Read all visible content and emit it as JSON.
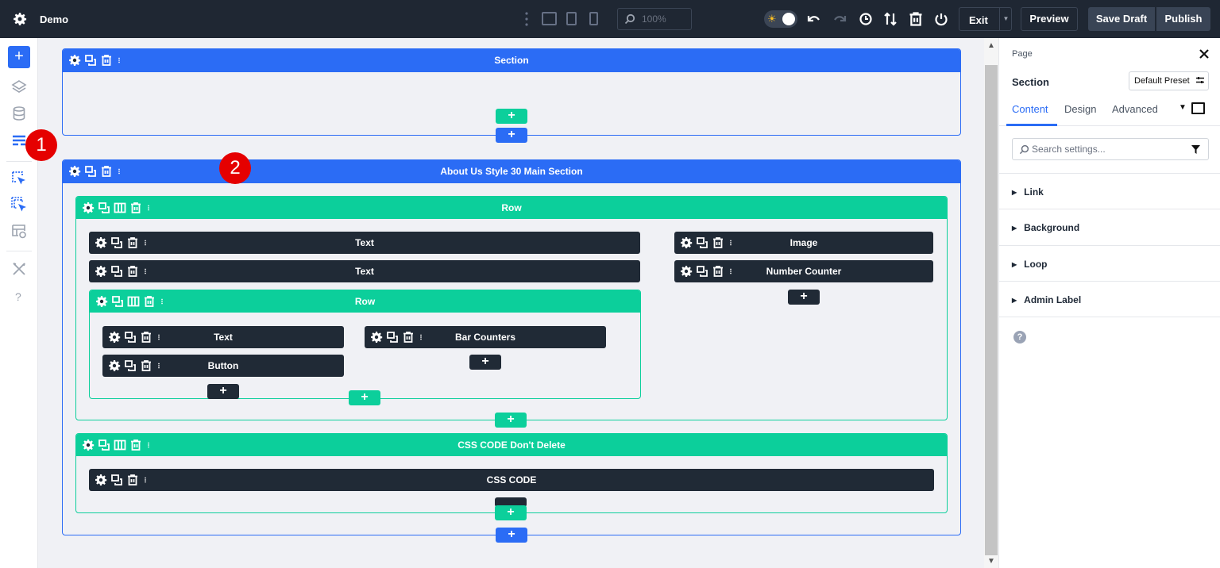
{
  "topbar": {
    "title": "Demo",
    "zoom_placeholder": "100%",
    "exit_label": "Exit",
    "preview_label": "Preview",
    "save_draft_label": "Save Draft",
    "publish_label": "Publish"
  },
  "sidebar": {
    "add_label": "+",
    "help_label": "?"
  },
  "annotations": [
    "1",
    "2"
  ],
  "canvas": {
    "section1": {
      "title": "Section"
    },
    "section2": {
      "title": "About Us Style 30 Main Section",
      "row1": {
        "title": "Row",
        "modules_left": [
          "Text",
          "Text"
        ],
        "modules_right": [
          "Image",
          "Number Counter"
        ],
        "inner_row": {
          "title": "Row",
          "col1_modules": [
            "Text",
            "Button"
          ],
          "col2_modules": [
            "Bar Counters"
          ]
        }
      },
      "row2": {
        "title": "CSS CODE Don't Delete",
        "modules": [
          "CSS CODE"
        ]
      }
    },
    "add_symbol": "+"
  },
  "panel": {
    "breadcrumb": "Page",
    "element_type": "Section",
    "preset_label": "Default Preset",
    "tabs": [
      "Content",
      "Design",
      "Advanced"
    ],
    "active_tab": "Content",
    "search_placeholder": "Search settings...",
    "groups": [
      "Link",
      "Background",
      "Loop",
      "Admin Label"
    ],
    "help_label": "?"
  },
  "colors": {
    "section_blue": "#2b6cf5",
    "row_green": "#0ccf9b",
    "module_dark": "#202a36",
    "topbar_bg": "#1f2733",
    "annotation_red": "#e50000"
  },
  "icons": {
    "module_controls": [
      "gear-icon",
      "duplicate-icon",
      "trash-icon",
      "more-vertical-icon"
    ],
    "row_controls": [
      "gear-icon",
      "duplicate-icon",
      "columns-icon",
      "trash-icon",
      "more-vertical-icon"
    ]
  }
}
